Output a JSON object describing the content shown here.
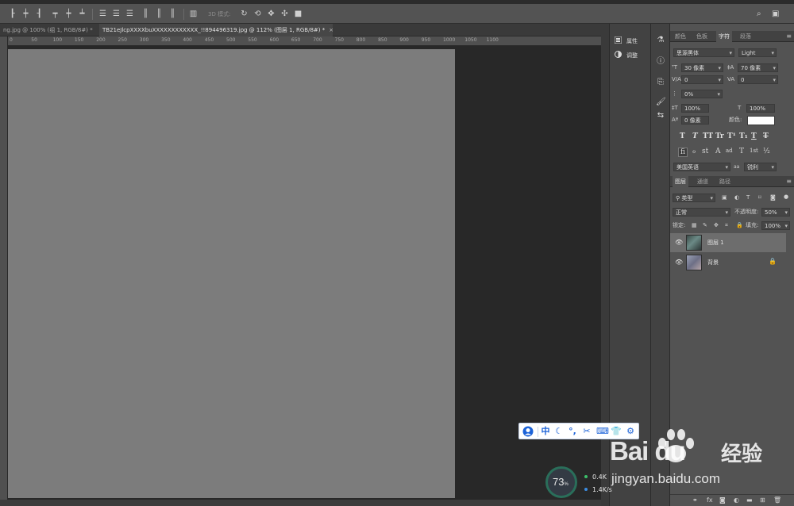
{
  "options_bar": {
    "mode_3d": "3D 模式:"
  },
  "tabs": [
    {
      "label": "ng.jpg @ 100% (组 1, RGB/8#) *",
      "close": "×"
    },
    {
      "label": "TB21eJlcpXXXXbuXXXXXXXXXXXX_!!894496319.jpg @ 112% (图层 1, RGB/8#) *",
      "close": "×"
    }
  ],
  "rulers": {
    "top_ticks": [
      "0",
      "50",
      "100",
      "150",
      "200",
      "250",
      "300",
      "350",
      "400",
      "450",
      "500",
      "550",
      "600",
      "650",
      "700",
      "750",
      "800",
      "850",
      "900",
      "950",
      "1000",
      "1050",
      "1100"
    ]
  },
  "properties_panel": {
    "properties_label": "属性",
    "adjustments_label": "调整"
  },
  "character_panel": {
    "tabs": [
      "颜色",
      "色板",
      "字符",
      "段落"
    ],
    "active_tab": "字符",
    "font_family": "思源黑体",
    "font_style": "Light",
    "font_size": "30 像素",
    "leading": "70 像素",
    "kerning": "0",
    "tracking": "0",
    "tsume": "0%",
    "vertical_scale": "100%",
    "horizontal_scale": "100%",
    "baseline_shift": "0 像素",
    "color_label": "颜色:",
    "color_value": "#ffffff",
    "type_styles": [
      "T",
      "T",
      "TT",
      "Tr",
      "T¹",
      "T₁",
      "T",
      "T"
    ],
    "opentype": [
      "fi",
      "ℴ",
      "st",
      "A",
      "ad",
      "T",
      "1st",
      "½"
    ],
    "language": "美国英语",
    "aa_label": "aa",
    "anti_alias": "锐利"
  },
  "layers_panel": {
    "tabs": [
      "图层",
      "通道",
      "路径"
    ],
    "active_tab": "图层",
    "filter_kind": "类型",
    "blend_mode": "正常",
    "opacity_label": "不透明度:",
    "opacity": "50%",
    "lock_label": "锁定:",
    "fill_label": "填充:",
    "fill": "100%",
    "layers": [
      {
        "name": "图层 1",
        "selected": true,
        "locked": false
      },
      {
        "name": "背景",
        "selected": false,
        "locked": true
      }
    ],
    "bottom_buttons": [
      "link-icon",
      "fx-icon",
      "mask-icon",
      "adjustment-icon",
      "folder-icon",
      "new-layer-icon",
      "trash-icon"
    ]
  },
  "ime_toolbar": {
    "lang": "中",
    "items": [
      "user-icon",
      "moon-icon",
      "punct-icon",
      "scissors-icon",
      "keyboard-icon",
      "shirt-icon",
      "gear-icon"
    ]
  },
  "speed_widget": {
    "percent": "73",
    "percent_unit": "%",
    "upload": "0.4K",
    "download": "1.4K/s"
  },
  "watermark": {
    "logo": "Bai du",
    "brand": "经验",
    "url": "jingyan.baidu.com"
  },
  "colors": {
    "canvas_gray": "#7c7c7c",
    "pasteboard": "#282828",
    "panel": "#535353",
    "ime_blue": "#1b62d8"
  }
}
